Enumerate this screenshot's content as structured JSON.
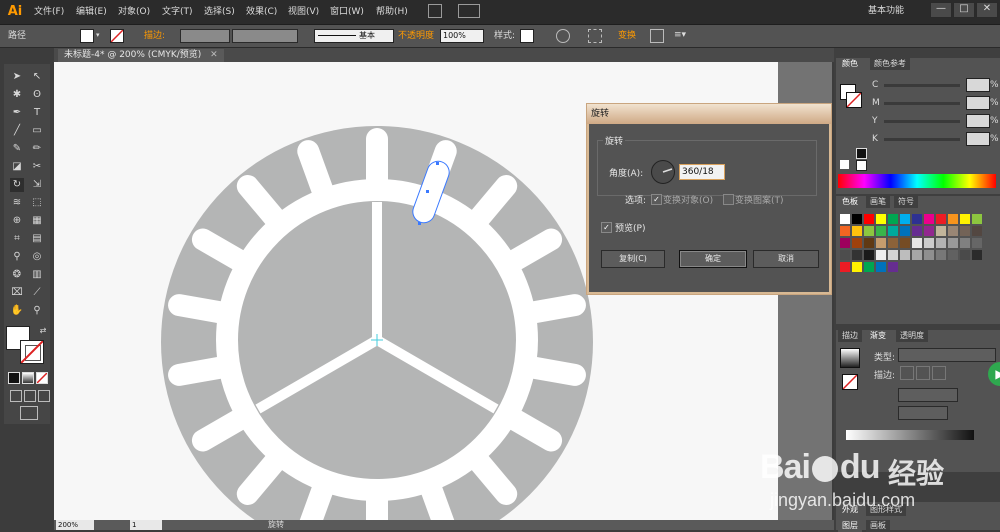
{
  "app": {
    "logo": "Ai",
    "menus": [
      "文件(F)",
      "编辑(E)",
      "对象(O)",
      "文字(T)",
      "选择(S)",
      "效果(C)",
      "视图(V)",
      "窗口(W)",
      "帮助(H)"
    ],
    "workspace": "基本功能",
    "window_controls": [
      "—",
      "□",
      "✕"
    ]
  },
  "control_bar": {
    "selection_label": "路径",
    "stroke_label": "描边:",
    "stroke_style": "基本",
    "opacity_label": "不透明度",
    "opacity_value": "100%",
    "style_label": "样式:",
    "transform_label": "变换"
  },
  "document": {
    "tab_title": "未标题-4* @ 200% (CMYK/预览)",
    "zoom": "200%",
    "page": "1",
    "status_text": "旋转"
  },
  "dialog": {
    "title": "旋转",
    "group_label": "旋转",
    "angle_label": "角度(A):",
    "angle_value": "360/18",
    "options_label": "选项:",
    "transform_objects_label": "变换对象(O)",
    "transform_objects_checked": true,
    "transform_patterns_label": "变换图案(T)",
    "transform_patterns_checked": false,
    "preview_label": "预览(P)",
    "preview_checked": true,
    "buttons": {
      "copy": "复制(C)",
      "ok": "确定",
      "cancel": "取消"
    }
  },
  "color_panel": {
    "tabs": [
      "颜色",
      "颜色参考"
    ],
    "channels": [
      "C",
      "M",
      "Y",
      "K"
    ],
    "percent": "%"
  },
  "swatches_panel": {
    "tabs": [
      "色板",
      "画笔",
      "符号"
    ]
  },
  "gradient_panel": {
    "tabs": [
      "描边",
      "渐变",
      "透明度"
    ],
    "type_label": "类型:",
    "stroke_label": "描边:"
  },
  "bottom_panel": {
    "tabs": [
      "外观",
      "图形样式"
    ],
    "layers_tabs": [
      "图层",
      "画板"
    ]
  },
  "watermark": {
    "brand": "Bai",
    "brand2": "du",
    "cn": "经验",
    "url": "jingyan.baidu.com"
  },
  "colors": {
    "accent": "#ff9a00",
    "artwork_gray": "#b4b5b5",
    "selection_blue": "#3a79ff"
  }
}
